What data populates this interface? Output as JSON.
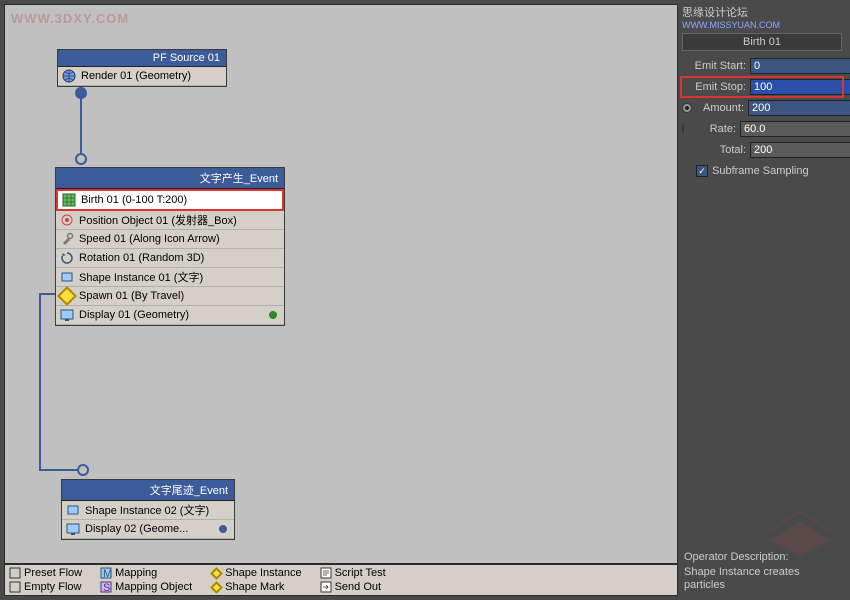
{
  "watermark": "WWW.3DXY.COM",
  "top_attrib": {
    "text": "思缘设计论坛",
    "url": "WWW.MISSYUAN.COM"
  },
  "nodes": {
    "source": {
      "title": "PF Source 01",
      "rows": [
        {
          "icon": "globe-icon",
          "label": "Render 01 (Geometry)"
        }
      ]
    },
    "event1": {
      "title": "文字产生_Event",
      "rows": [
        {
          "icon": "grid-icon",
          "label": "Birth 01 (0-100 T:200)",
          "highlight": true
        },
        {
          "icon": "target-icon",
          "label": "Position Object 01 (发射器_Box)"
        },
        {
          "icon": "wrench-icon",
          "label": "Speed 01 (Along Icon Arrow)"
        },
        {
          "icon": "rotate-icon",
          "label": "Rotation 01 (Random 3D)"
        },
        {
          "icon": "shape-icon",
          "label": "Shape Instance 01 (文字)"
        },
        {
          "icon": "diamond-icon",
          "label": "Spawn 01 (By Travel)"
        },
        {
          "icon": "display-icon",
          "label": "Display 01 (Geometry)",
          "dot": "green"
        }
      ]
    },
    "event2": {
      "title": "文字尾迹_Event",
      "rows": [
        {
          "icon": "shape-icon",
          "label": "Shape Instance 02 (文字)"
        },
        {
          "icon": "display-icon",
          "label": "Display 02 (Geome...",
          "dot": "blue"
        }
      ]
    }
  },
  "toolbar": [
    [
      {
        "icon": "preset-icon",
        "label": "Preset Flow"
      },
      {
        "icon": "empty-icon",
        "label": "Empty Flow"
      }
    ],
    [
      {
        "icon": "mapping-icon",
        "label": "Mapping"
      },
      {
        "icon": "mapping-obj-icon",
        "label": "Mapping Object"
      }
    ],
    [
      {
        "icon": "diamond-icon",
        "label": "Shape Instance"
      },
      {
        "icon": "diamond-icon",
        "label": "Shape Mark"
      }
    ],
    [
      {
        "icon": "script-icon",
        "label": "Script Test"
      },
      {
        "icon": "send-icon",
        "label": "Send Out"
      }
    ]
  ],
  "panel": {
    "title": "Birth 01",
    "params": {
      "emit_start_label": "Emit Start:",
      "emit_start": "0",
      "emit_stop_label": "Emit Stop:",
      "emit_stop": "100",
      "amount_label": "Amount:",
      "amount": "200",
      "rate_label": "Rate:",
      "rate": "60.0",
      "total_label": "Total:",
      "total": "200",
      "subframe_label": "Subframe Sampling"
    }
  },
  "description": {
    "title": "Operator Description:",
    "body": "Shape Instance creates particles"
  }
}
